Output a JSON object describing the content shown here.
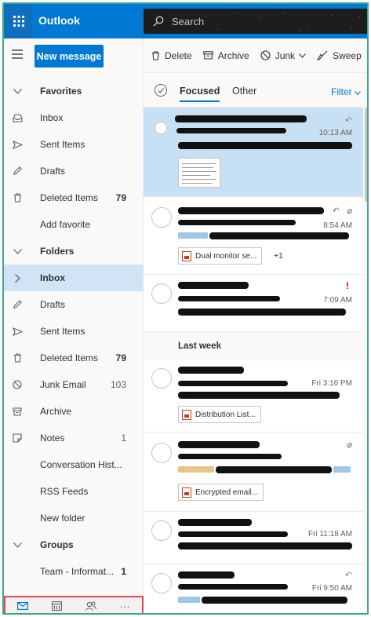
{
  "app": {
    "title": "Outlook"
  },
  "search": {
    "placeholder": "Search"
  },
  "toolbar": {
    "new_message": "New message",
    "delete": "Delete",
    "archive": "Archive",
    "junk": "Junk",
    "sweep": "Sweep"
  },
  "folders_pane": {
    "favorites_header": "Favorites",
    "favorites": [
      {
        "label": "Inbox",
        "icon": "inbox-icon",
        "count": ""
      },
      {
        "label": "Sent Items",
        "icon": "send-icon",
        "count": ""
      },
      {
        "label": "Drafts",
        "icon": "pencil-icon",
        "count": ""
      },
      {
        "label": "Deleted Items",
        "icon": "trash-icon",
        "count": "79"
      },
      {
        "label": "Add favorite",
        "icon": "",
        "count": ""
      }
    ],
    "folders_header": "Folders",
    "folders": [
      {
        "label": "Inbox",
        "icon": "chevron-right-icon",
        "count": ""
      },
      {
        "label": "Drafts",
        "icon": "pencil-icon",
        "count": ""
      },
      {
        "label": "Sent Items",
        "icon": "send-icon",
        "count": ""
      },
      {
        "label": "Deleted Items",
        "icon": "trash-icon",
        "count": "79"
      },
      {
        "label": "Junk Email",
        "icon": "block-icon",
        "count": "103"
      },
      {
        "label": "Archive",
        "icon": "archive-icon",
        "count": ""
      },
      {
        "label": "Notes",
        "icon": "note-icon",
        "count": "1"
      },
      {
        "label": "Conversation Hist...",
        "icon": "",
        "count": ""
      },
      {
        "label": "RSS Feeds",
        "icon": "",
        "count": ""
      },
      {
        "label": "New folder",
        "icon": "",
        "count": ""
      }
    ],
    "groups_header": "Groups",
    "groups": [
      {
        "label": "Team - Informat...",
        "count": "1"
      }
    ],
    "bottom_nav": [
      "mail-icon",
      "calendar-icon",
      "people-icon",
      "more-icon"
    ],
    "bottom_more": "···"
  },
  "message_list": {
    "tab_focused": "Focused",
    "tab_other": "Other",
    "filter": "Filter",
    "section_last_week": "Last week",
    "messages": [
      {
        "time": "10:13 AM",
        "attachment": "",
        "extra": ""
      },
      {
        "time": "8:54 AM",
        "attachment": "Dual monitor se...",
        "extra": "+1"
      },
      {
        "time": "7:09 AM",
        "attachment": "",
        "extra": ""
      },
      {
        "time": "Fri 3:16 PM",
        "attachment": "Distribution List...",
        "extra": ""
      },
      {
        "time": "",
        "attachment": "Encrypted email...",
        "extra": ""
      },
      {
        "time": "Fri 11:18 AM",
        "attachment": "",
        "extra": ""
      },
      {
        "time": "Fri 9:50 AM",
        "attachment": "",
        "extra": ""
      }
    ],
    "flag": "!"
  },
  "colors": {
    "accent": "#0078d4",
    "selected": "#c7e0f4",
    "highlight_box": "#e34646"
  }
}
